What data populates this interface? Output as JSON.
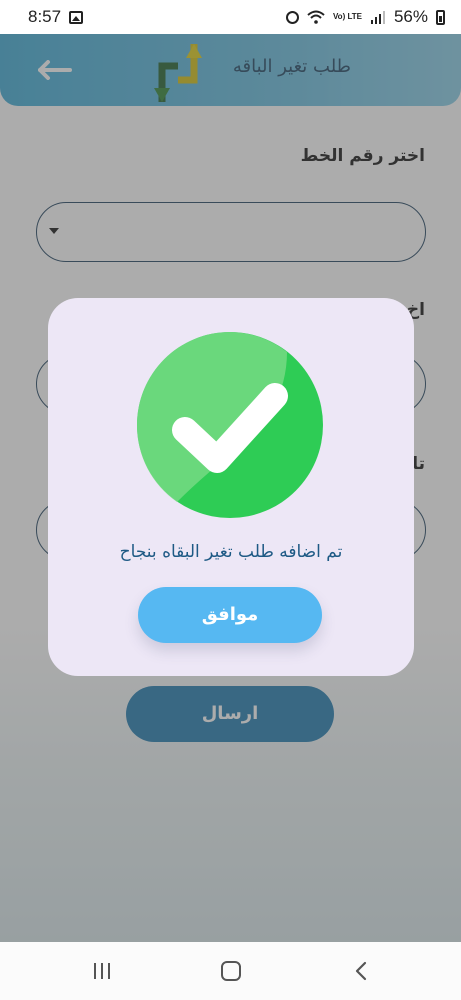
{
  "status_bar": {
    "time": "8:57",
    "battery": "56%",
    "volte": "Vo) LTE"
  },
  "header": {
    "title": "طلب تغير الباقه"
  },
  "form": {
    "line_label": "اختر رقم الخط",
    "package_label": "اخ",
    "date_label": "تا",
    "submit_label": "ارسال"
  },
  "dialog": {
    "message": "تم اضافه طلب تغير البقاه بنجاح",
    "ok_label": "موافق",
    "accent_color": "#56b8f2",
    "success_color": "#2ecc55"
  },
  "icons": {
    "back": "arrow-left-icon",
    "logo": "swap-arrows-logo-icon",
    "success": "checkmark-circle-icon"
  }
}
